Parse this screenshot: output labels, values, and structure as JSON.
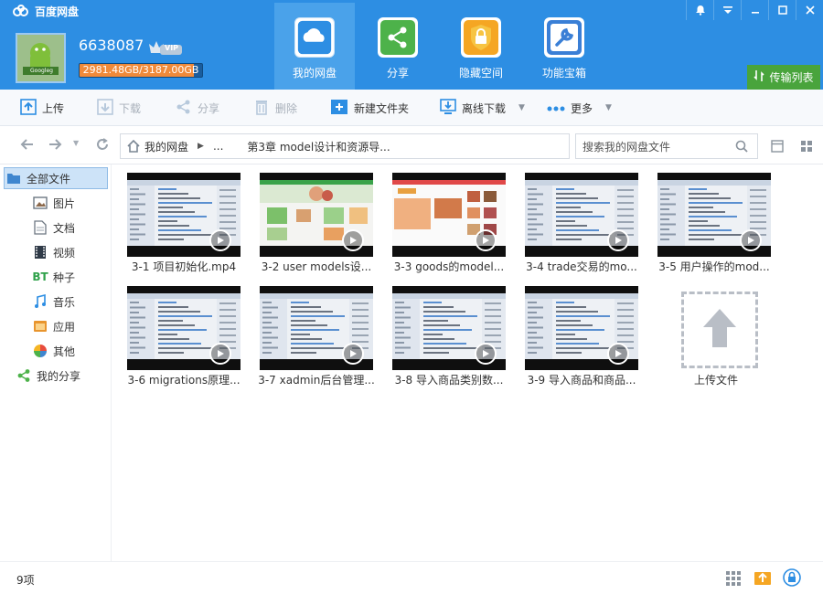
{
  "app": {
    "title": "百度网盘"
  },
  "user": {
    "name": "6638087",
    "vip_label": "VIP",
    "quota_text": "2981.48GB/3187.00GB",
    "quota_used_fraction": 0.935,
    "avatar_caption": "Googleg"
  },
  "nav_tabs": [
    {
      "label": "我的网盘",
      "icon": "cloud-icon",
      "active": true
    },
    {
      "label": "分享",
      "icon": "share-icon",
      "active": false
    },
    {
      "label": "隐藏空间",
      "icon": "lock-icon",
      "active": false
    },
    {
      "label": "功能宝箱",
      "icon": "tools-icon",
      "active": false
    }
  ],
  "transfer_label": "传输列表",
  "toolbar": {
    "upload": "上传",
    "download": "下载",
    "share": "分享",
    "delete": "删除",
    "new_folder": "新建文件夹",
    "offline_download": "离线下载",
    "more": "更多"
  },
  "breadcrumb": {
    "root": "我的网盘",
    "ellipsis": "...",
    "current": "第3章 model设计和资源导..."
  },
  "search": {
    "placeholder": "搜索我的网盘文件"
  },
  "sidebar": [
    {
      "label": "全部文件",
      "icon": "folder-icon",
      "active": true
    },
    {
      "label": "图片",
      "icon": "image-icon"
    },
    {
      "label": "文档",
      "icon": "document-icon"
    },
    {
      "label": "视频",
      "icon": "video-icon"
    },
    {
      "label": "种子",
      "icon": "bt-icon"
    },
    {
      "label": "音乐",
      "icon": "music-icon"
    },
    {
      "label": "应用",
      "icon": "app-icon"
    },
    {
      "label": "其他",
      "icon": "other-icon"
    },
    {
      "label": "我的分享",
      "icon": "share-icon"
    }
  ],
  "files": [
    {
      "name": "3-1 项目初始化.mp4",
      "thumb": "ide"
    },
    {
      "name": "3-2 user models设...",
      "thumb": "shop-green"
    },
    {
      "name": "3-3 goods的model...",
      "thumb": "shop-food"
    },
    {
      "name": "3-4 trade交易的mo...",
      "thumb": "ide"
    },
    {
      "name": "3-5 用户操作的mod...",
      "thumb": "ide"
    },
    {
      "name": "3-6 migrations原理...",
      "thumb": "ide"
    },
    {
      "name": "3-7 xadmin后台管理...",
      "thumb": "ide"
    },
    {
      "name": "3-8 导入商品类别数...",
      "thumb": "ide"
    },
    {
      "name": "3-9 导入商品和商品...",
      "thumb": "ide"
    }
  ],
  "upload_tile": {
    "label": "上传文件"
  },
  "status": {
    "count": "9项"
  },
  "colors": {
    "header": "#2d8ee3",
    "active_tab": "#4aa2ea",
    "transfer": "#49a43c",
    "quota_fill": "#f08a3a"
  }
}
